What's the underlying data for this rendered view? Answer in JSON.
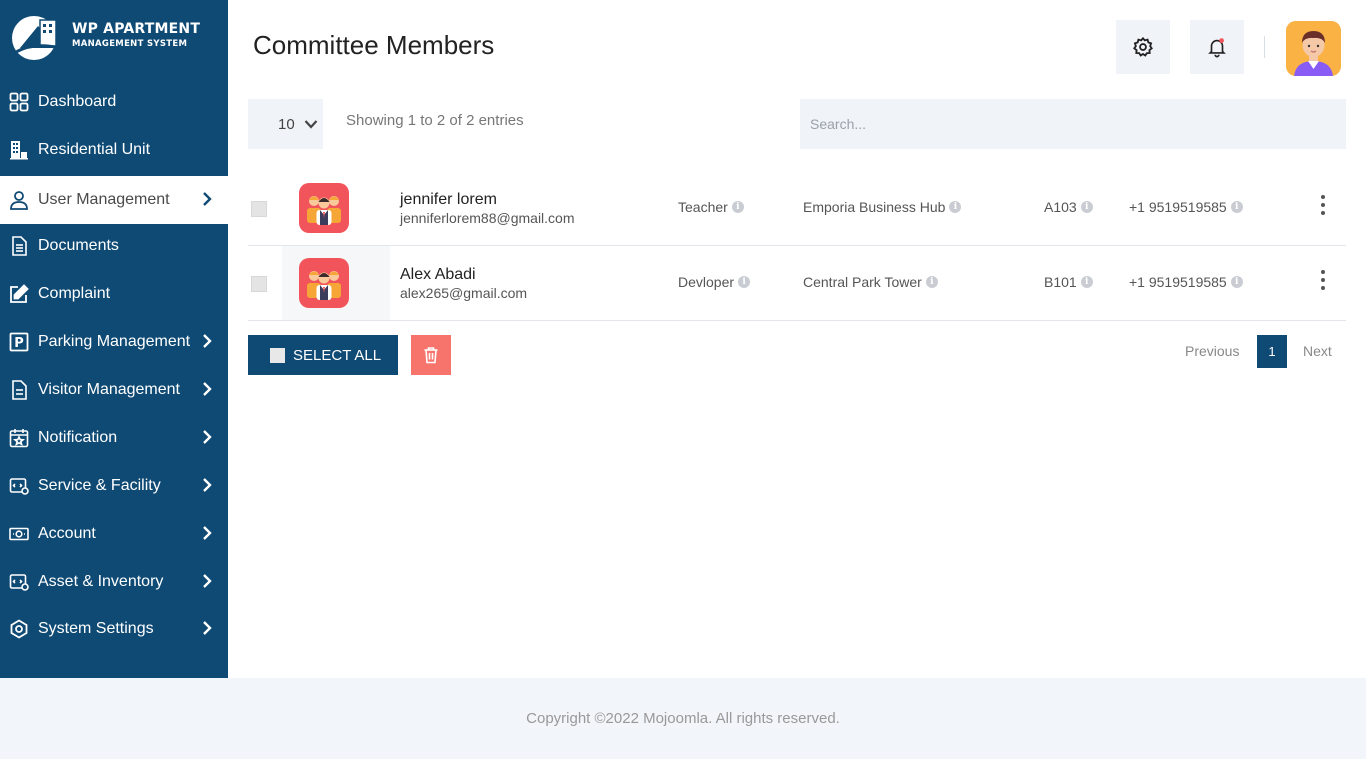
{
  "brand": {
    "line1": "WP APARTMENT",
    "line2": "MANAGEMENT SYSTEM"
  },
  "sidebar": {
    "items": [
      {
        "label": "Dashboard",
        "icon": "dashboard-grid-icon"
      },
      {
        "label": "Residential Unit",
        "icon": "building-icon"
      },
      {
        "label": "User Management",
        "icon": "user-icon",
        "active": true
      },
      {
        "label": "Documents",
        "icon": "document-icon"
      },
      {
        "label": "Complaint",
        "icon": "edit-icon"
      },
      {
        "label": "Parking Management",
        "icon": "parking-icon"
      },
      {
        "label": "Visitor Management",
        "icon": "visitor-file-icon"
      },
      {
        "label": "Notification",
        "icon": "calendar-star-icon"
      },
      {
        "label": "Service & Facility",
        "icon": "service-icon"
      },
      {
        "label": "Account",
        "icon": "money-icon"
      },
      {
        "label": "Asset & Inventory",
        "icon": "asset-icon"
      },
      {
        "label": "System Settings",
        "icon": "settings-hex-icon"
      }
    ]
  },
  "header": {
    "title": "Committee Members"
  },
  "table": {
    "page_length": "10",
    "info": "Showing 1 to 2 of 2 entries",
    "search_placeholder": "Search...",
    "rows": [
      {
        "name": "jennifer lorem",
        "email": "jenniferlorem88@gmail.com",
        "occupation": "Teacher",
        "building": "Emporia Business Hub",
        "unit": "A103",
        "phone": "+1 9519519585"
      },
      {
        "name": "Alex Abadi",
        "email": "alex265@gmail.com",
        "occupation": "Devloper",
        "building": "Central Park Tower",
        "unit": "B101",
        "phone": "+1 9519519585"
      }
    ]
  },
  "actions": {
    "select_all_label": "SELECT ALL"
  },
  "pagination": {
    "previous": "Previous",
    "current": "1",
    "next": "Next"
  },
  "footer": {
    "copyright": "Copyright ©2022 Mojoomla. All rights reserved."
  },
  "colors": {
    "sidebar": "#0f4a74",
    "accent": "#0f4a74",
    "danger": "#f7746d",
    "row_icon": "#f2545b",
    "avatar_bg": "#f9b243"
  }
}
